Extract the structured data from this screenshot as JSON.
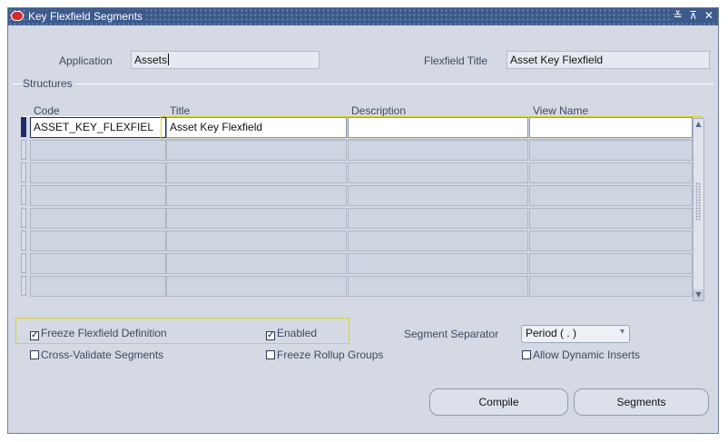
{
  "window": {
    "title": "Key Flexfield Segments",
    "controls": "≚ ⊼ ✕"
  },
  "header": {
    "application_label": "Application",
    "application_value": "Assets",
    "flexfield_title_label": "Flexfield Title",
    "flexfield_title_value": "Asset Key Flexfield"
  },
  "structures": {
    "group_label": "Structures",
    "columns": [
      "Code",
      "Title",
      "Description",
      "View Name"
    ],
    "rows": [
      {
        "code": "ASSET_KEY_FLEXFIEL",
        "title": "Asset Key Flexfield",
        "description": "",
        "view_name": ""
      },
      {
        "code": "",
        "title": "",
        "description": "",
        "view_name": ""
      },
      {
        "code": "",
        "title": "",
        "description": "",
        "view_name": ""
      },
      {
        "code": "",
        "title": "",
        "description": "",
        "view_name": ""
      },
      {
        "code": "",
        "title": "",
        "description": "",
        "view_name": ""
      },
      {
        "code": "",
        "title": "",
        "description": "",
        "view_name": ""
      },
      {
        "code": "",
        "title": "",
        "description": "",
        "view_name": ""
      },
      {
        "code": "",
        "title": "",
        "description": "",
        "view_name": ""
      }
    ]
  },
  "options": {
    "freeze_flexfield_definition": {
      "label": "Freeze Flexfield Definition",
      "checked": true
    },
    "enabled": {
      "label": "Enabled",
      "checked": true
    },
    "cross_validate_segments": {
      "label": "Cross-Validate Segments",
      "checked": false
    },
    "freeze_rollup_groups": {
      "label": "Freeze Rollup Groups",
      "checked": false
    },
    "allow_dynamic_inserts": {
      "label": "Allow Dynamic Inserts",
      "checked": false
    },
    "segment_separator_label": "Segment Separator",
    "segment_separator_value": "Period ( . )"
  },
  "buttons": {
    "compile": "Compile",
    "segments": "Segments"
  },
  "colors": {
    "title_bar": "#3c5a8c",
    "window_bg": "#d4d9e4",
    "highlight_box": "#d9d22c"
  }
}
